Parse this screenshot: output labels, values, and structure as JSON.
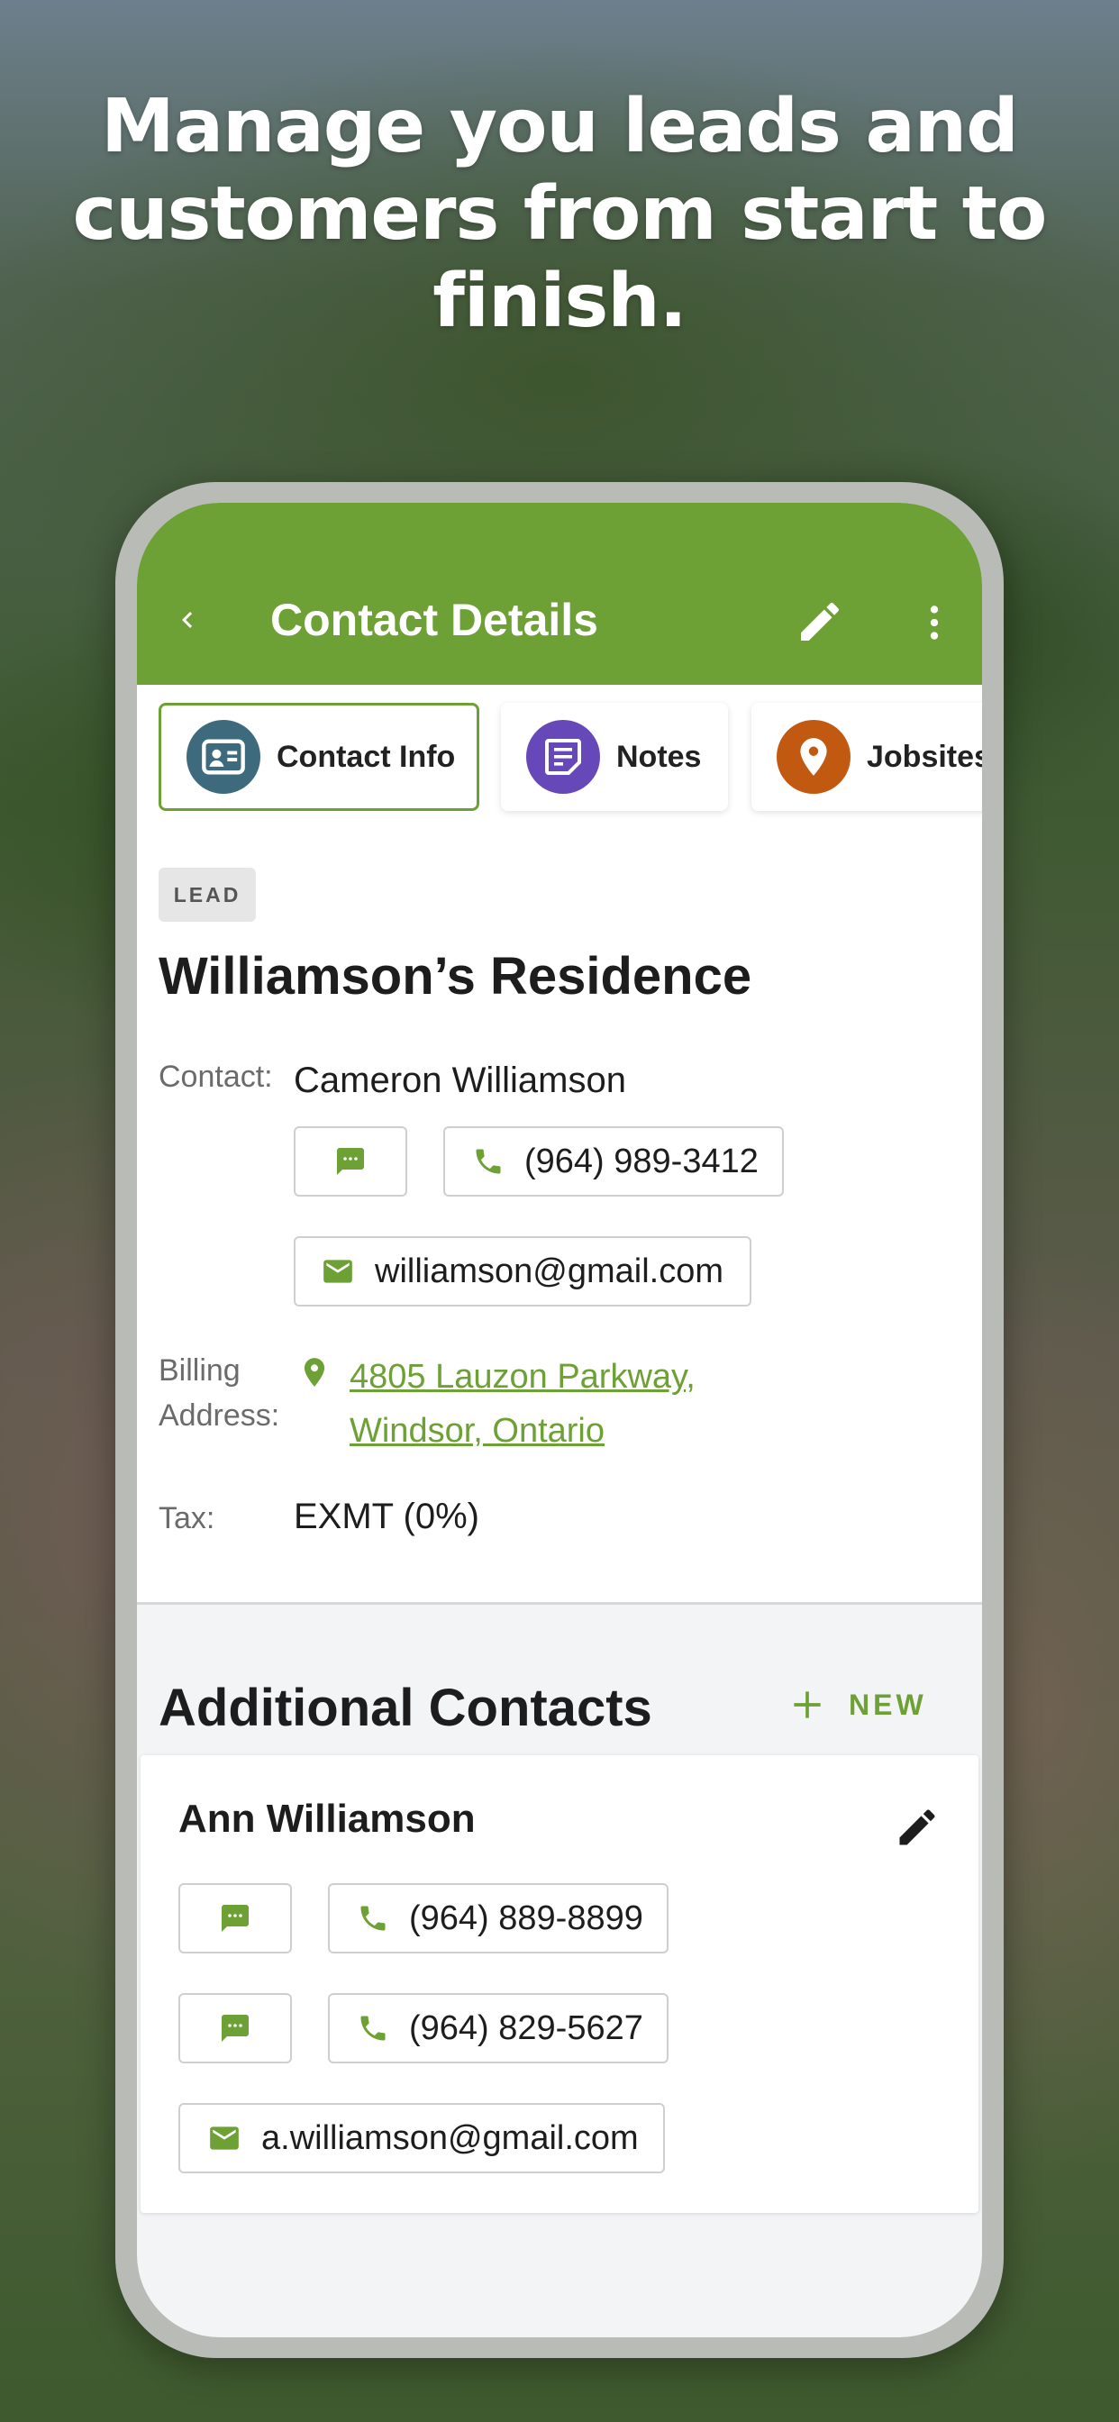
{
  "headline": "Manage you leads and customers from start to finish.",
  "appbar": {
    "title": "Contact Details"
  },
  "tabs": [
    {
      "label": "Contact Info",
      "icon": "contact-card-icon",
      "color": "#3d6b7d",
      "active": true
    },
    {
      "label": "Notes",
      "icon": "note-icon",
      "color": "#6648b8",
      "active": false
    },
    {
      "label": "Jobsites",
      "icon": "location-pin-icon",
      "color": "#c25911",
      "active": false
    }
  ],
  "lead": {
    "badge": "LEAD",
    "name": "Williamson’s Residence",
    "contact_label": "Contact:",
    "contact_name": "Cameron Williamson",
    "phone": "(964) 989-3412",
    "email": "williamson@gmail.com",
    "billing_label_1": "Billing",
    "billing_label_2": "Address:",
    "address_line_1": "4805 Lauzon Parkway,",
    "address_line_2": "Windsor, Ontario",
    "tax_label": "Tax:",
    "tax_value": "EXMT (0%)"
  },
  "additional_contacts": {
    "title": "Additional Contacts",
    "new_label": "NEW",
    "contacts": [
      {
        "name": "Ann Williamson",
        "phones": [
          "(964) 889-8899",
          "(964) 829-5627"
        ],
        "email": "a.williamson@gmail.com"
      }
    ]
  },
  "colors": {
    "brand_green": "#6da035",
    "contact_info_icon": "#3d6b7d",
    "notes_icon": "#6648b8",
    "jobsites_icon": "#c25911"
  }
}
